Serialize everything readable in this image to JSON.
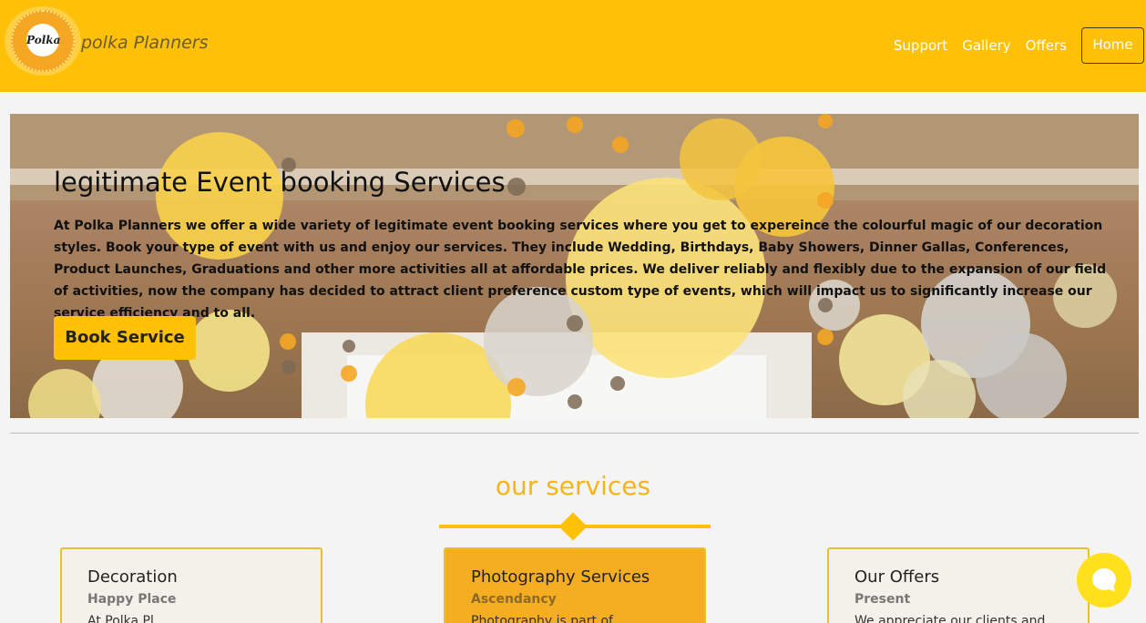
{
  "brand": {
    "logo_text": "Polka",
    "name": "polka Planners"
  },
  "nav": {
    "links": [
      "Support",
      "Gallery",
      "Offers"
    ],
    "home": "Home"
  },
  "hero": {
    "title": "legitimate Event booking Services",
    "text": "At Polka Planners we offer a wide variety of legitimate event booking services where you get to expereince the colourful magic of our decoration styles. Book your type of event with us and enjoy our services. They include Wedding, Birthdays, Baby Showers, Dinner Gallas, Conferences, Product Launches, Graduations and other more activities all at affordable prices. We deliver reliably and flexibly due to the expansion of our field of activities, now the company has decided to attract client preference custom type of events, which will impact us to significantly increase our service efficiency and to all.",
    "button": "Book Service"
  },
  "services": {
    "title": "our services",
    "cards": [
      {
        "title": "Decoration",
        "subtitle": "Happy Place",
        "body": "At Polka Pl..."
      },
      {
        "title": "Photography Services",
        "subtitle": "Ascendancy",
        "body": "Photography is part of..."
      },
      {
        "title": "Our Offers",
        "subtitle": "Present",
        "body": "We appreciate our clients and..."
      }
    ]
  },
  "colors": {
    "accent": "#ffc107",
    "title": "#f5b417",
    "card_highlight": "#f5ad21"
  },
  "icons": {
    "chat": "chat-bubble-icon"
  }
}
